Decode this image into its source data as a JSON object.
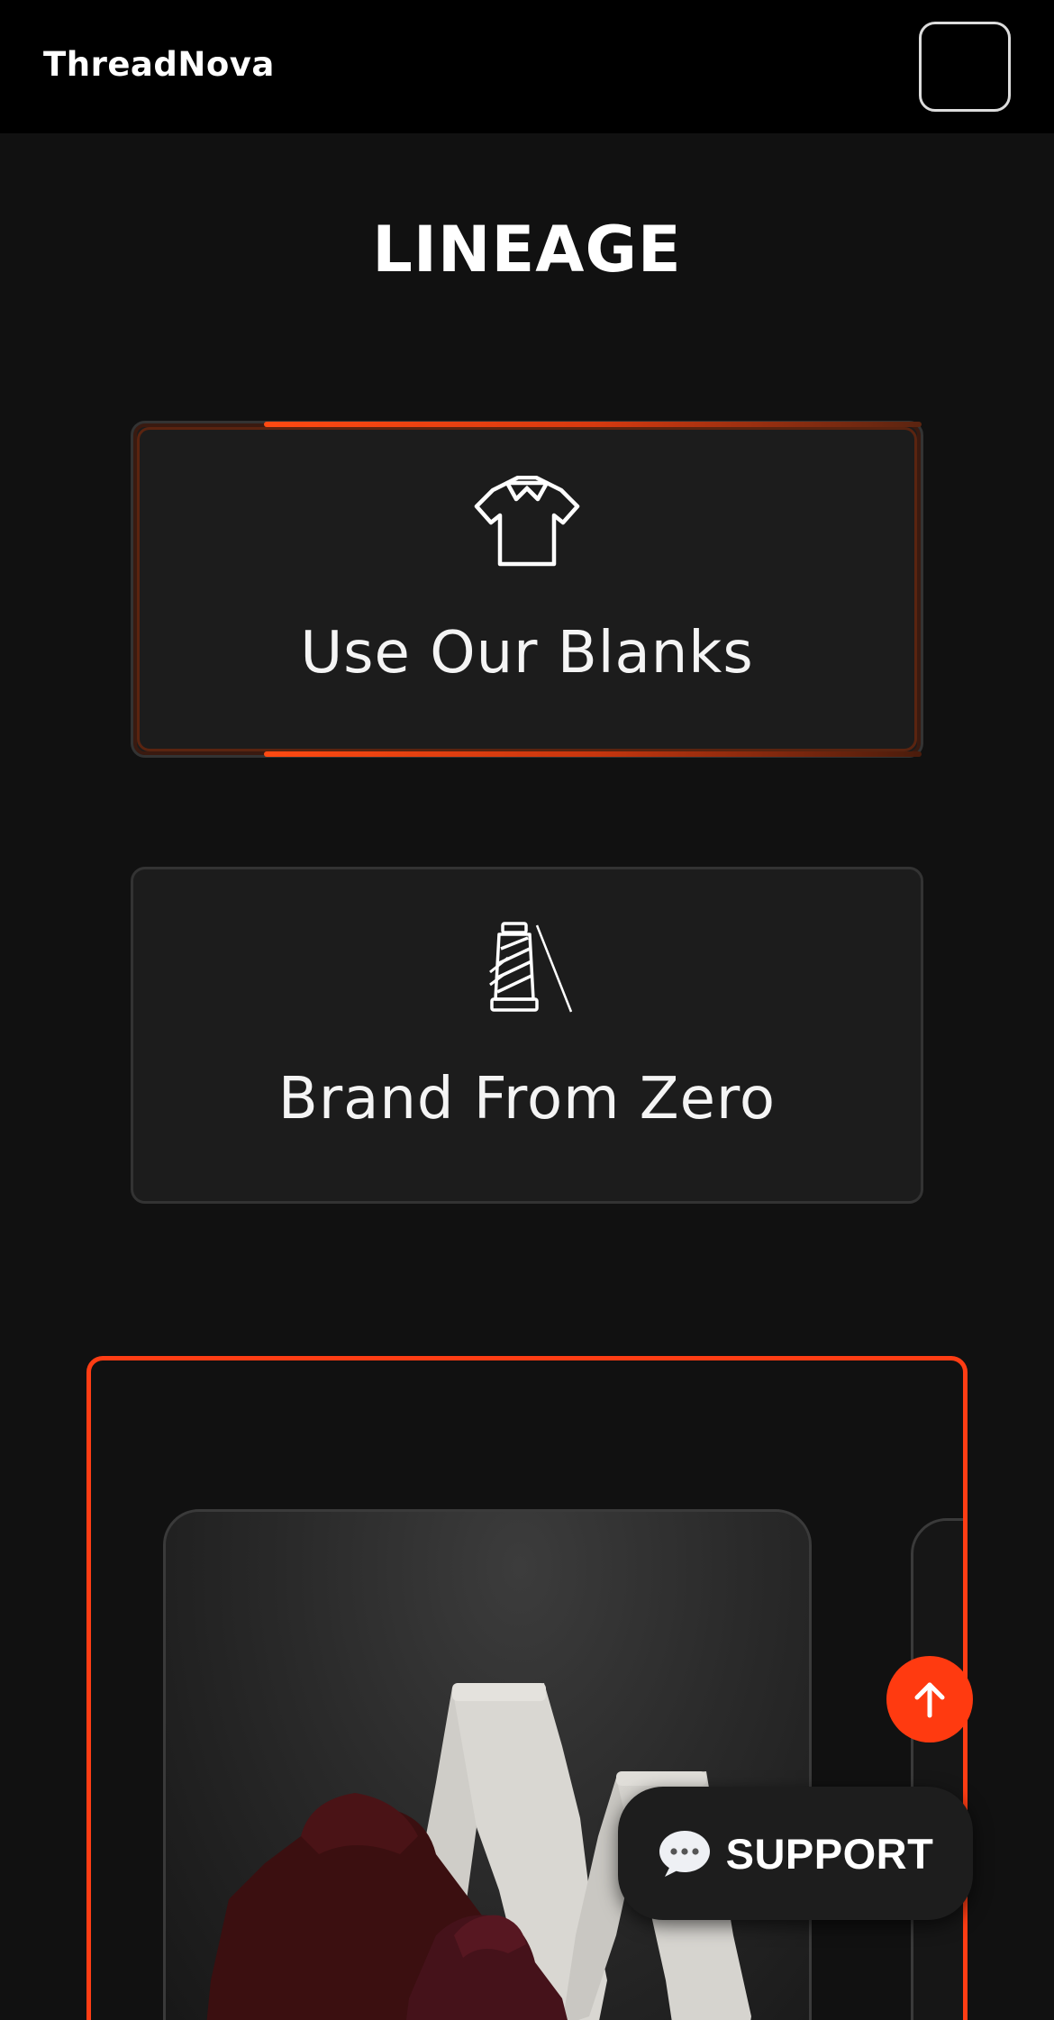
{
  "header": {
    "brand": "ThreadNova",
    "menu_icon": "menu-icon"
  },
  "section": {
    "title": "LINEAGE"
  },
  "cards": [
    {
      "label": "Use Our Blanks",
      "icon": "tshirt-icon",
      "active": true
    },
    {
      "label": "Brand From Zero",
      "icon": "thread-spool-needle-icon",
      "active": false
    }
  ],
  "showcase": {
    "image": "hoodie-and-sweatpants-product-image"
  },
  "floating": {
    "scroll_top_icon": "arrow-up-icon",
    "support_label": "SUPPORT",
    "support_icon": "speech-bubble-icon"
  },
  "colors": {
    "accent": "#ff3d14",
    "background": "#111111",
    "card": "#1c1c1c",
    "header": "#000000"
  }
}
